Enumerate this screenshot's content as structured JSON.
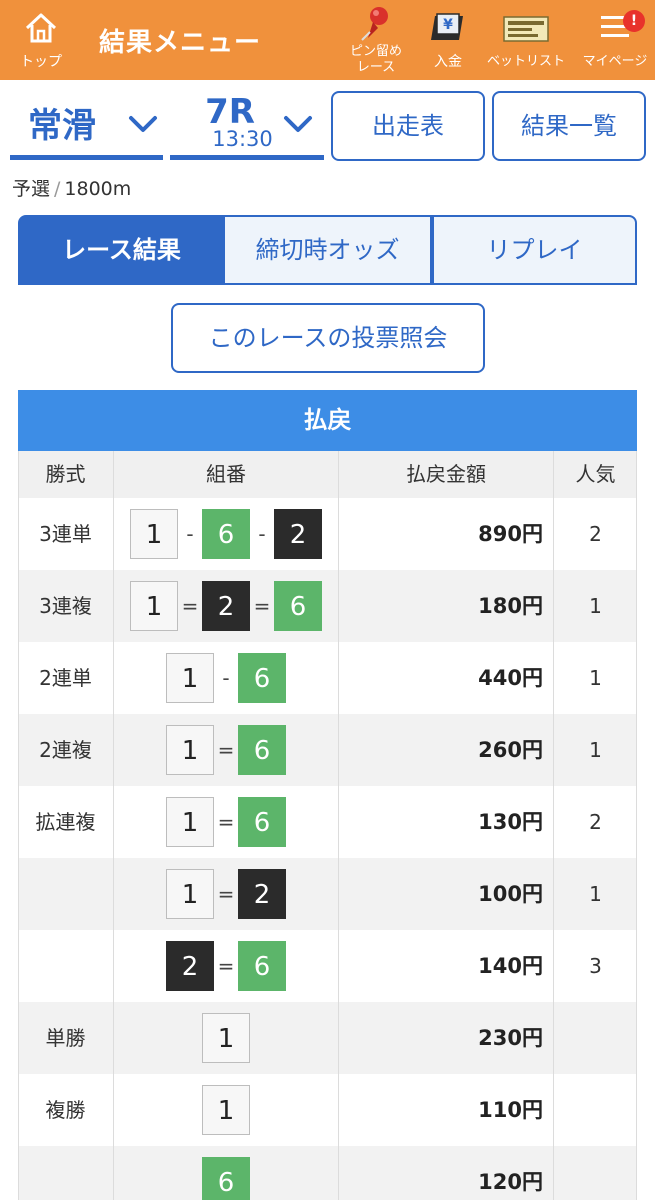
{
  "header": {
    "home_label": "トップ",
    "title": "結果メニュー",
    "pin_label_1": "ピン留め",
    "pin_label_2": "レース",
    "deposit_label": "入金",
    "betlist_label": "ベットリスト",
    "mypage_label": "マイページ",
    "badge": "!",
    "color": "#f0913c"
  },
  "selector": {
    "venue": "常滑",
    "race": "7R",
    "time": "13:30",
    "entry_button": "出走表",
    "results_list_button": "結果一覧"
  },
  "race_info": {
    "category": "予選",
    "separator": "/",
    "distance": "1800m"
  },
  "tabs": [
    {
      "label": "レース結果",
      "active": true
    },
    {
      "label": "締切時オッズ",
      "active": false
    },
    {
      "label": "リプレイ",
      "active": false
    }
  ],
  "vote_query_button": "このレースの投票照会",
  "payout": {
    "title": "払戻",
    "columns": [
      "勝式",
      "組番",
      "払戻金額",
      "人気"
    ],
    "rows": [
      {
        "type": "3連単",
        "combo": [
          "1",
          "-",
          "6",
          "-",
          "2"
        ],
        "amount": "890円",
        "pop": "2"
      },
      {
        "type": "3連複",
        "combo": [
          "1",
          "=",
          "2",
          "=",
          "6"
        ],
        "amount": "180円",
        "pop": "1"
      },
      {
        "type": "2連単",
        "combo": [
          "1",
          "-",
          "6"
        ],
        "amount": "440円",
        "pop": "1"
      },
      {
        "type": "2連複",
        "combo": [
          "1",
          "=",
          "6"
        ],
        "amount": "260円",
        "pop": "1"
      },
      {
        "type": "拡連複",
        "combo": [
          "1",
          "=",
          "6"
        ],
        "amount": "130円",
        "pop": "2"
      },
      {
        "type": "",
        "combo": [
          "1",
          "=",
          "2"
        ],
        "amount": "100円",
        "pop": "1"
      },
      {
        "type": "",
        "combo": [
          "2",
          "=",
          "6"
        ],
        "amount": "140円",
        "pop": "3"
      },
      {
        "type": "単勝",
        "combo": [
          "1"
        ],
        "amount": "230円",
        "pop": ""
      },
      {
        "type": "複勝",
        "combo": [
          "1"
        ],
        "amount": "110円",
        "pop": ""
      },
      {
        "type": "",
        "combo": [
          "6"
        ],
        "amount": "120円",
        "pop": ""
      }
    ]
  },
  "colors": {
    "accent_blue": "#2f68c6",
    "table_header": "#3d8de6",
    "boat_2": "#2b2b2b",
    "boat_6": "#5cb56a",
    "boat_1": "#f7f7f7"
  }
}
